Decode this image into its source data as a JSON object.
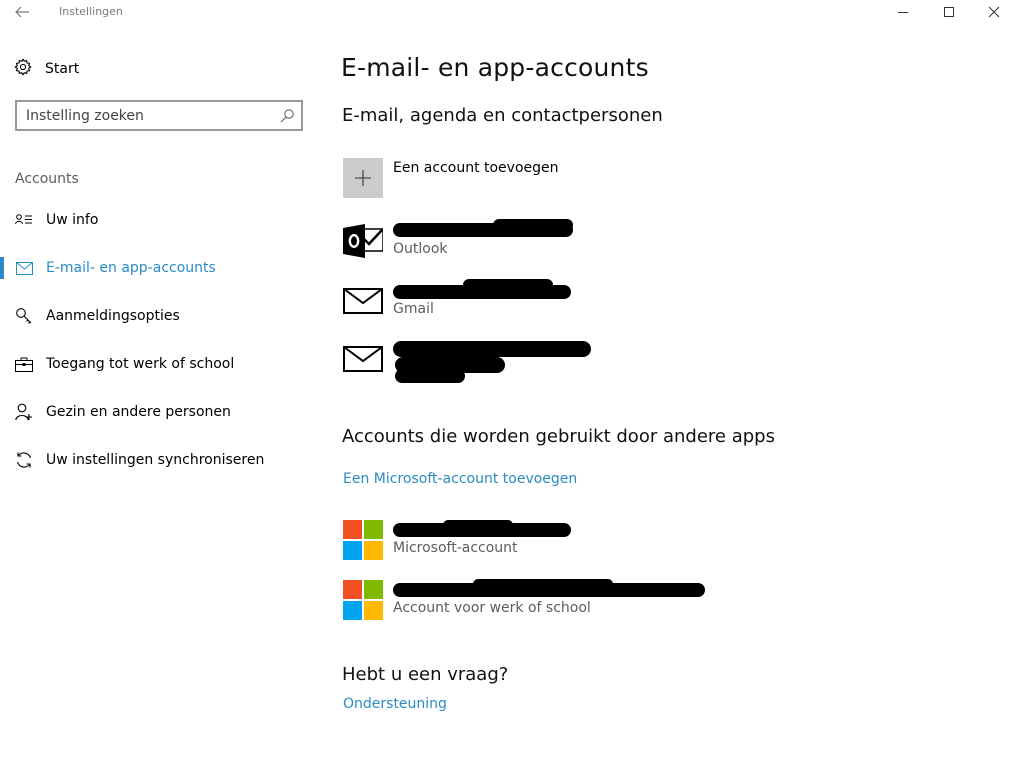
{
  "window": {
    "title": "Instellingen"
  },
  "sidebar": {
    "home_label": "Start",
    "search_placeholder": "Instelling zoeken",
    "group_title": "Accounts",
    "items": [
      {
        "label": "Uw info",
        "icon": "person-card-icon",
        "active": false
      },
      {
        "label": "E-mail- en app-accounts",
        "icon": "mail-icon",
        "active": true
      },
      {
        "label": "Aanmeldingsopties",
        "icon": "key-icon",
        "active": false
      },
      {
        "label": "Toegang tot werk of school",
        "icon": "briefcase-icon",
        "active": false
      },
      {
        "label": "Gezin en andere personen",
        "icon": "person-add-icon",
        "active": false
      },
      {
        "label": "Uw instellingen synchroniseren",
        "icon": "sync-icon",
        "active": false
      }
    ]
  },
  "main": {
    "title": "E-mail- en app-accounts",
    "email_section": {
      "title": "E-mail, agenda en contactpersonen",
      "add_label": "Een account toevoegen",
      "accounts": [
        {
          "type": "Outlook",
          "icon": "outlook-icon"
        },
        {
          "type": "Gmail",
          "icon": "mail-envelope-icon"
        },
        {
          "type": "",
          "icon": "mail-envelope-icon"
        }
      ]
    },
    "apps_section": {
      "title": "Accounts die worden gebruikt door andere apps",
      "add_link": "Een Microsoft-account toevoegen",
      "accounts": [
        {
          "type": "Microsoft-account",
          "icon": "microsoft-logo-icon"
        },
        {
          "type": "Account voor werk of school",
          "icon": "microsoft-logo-icon"
        }
      ]
    },
    "help_section": {
      "title": "Hebt u een vraag?",
      "link": "Ondersteuning"
    }
  },
  "colors": {
    "accent": "#2a8bc4",
    "secondary_text": "#5d5d5d",
    "ms_red": "#f25022",
    "ms_green": "#7fba00",
    "ms_blue": "#00a4ef",
    "ms_yellow": "#ffb900"
  }
}
